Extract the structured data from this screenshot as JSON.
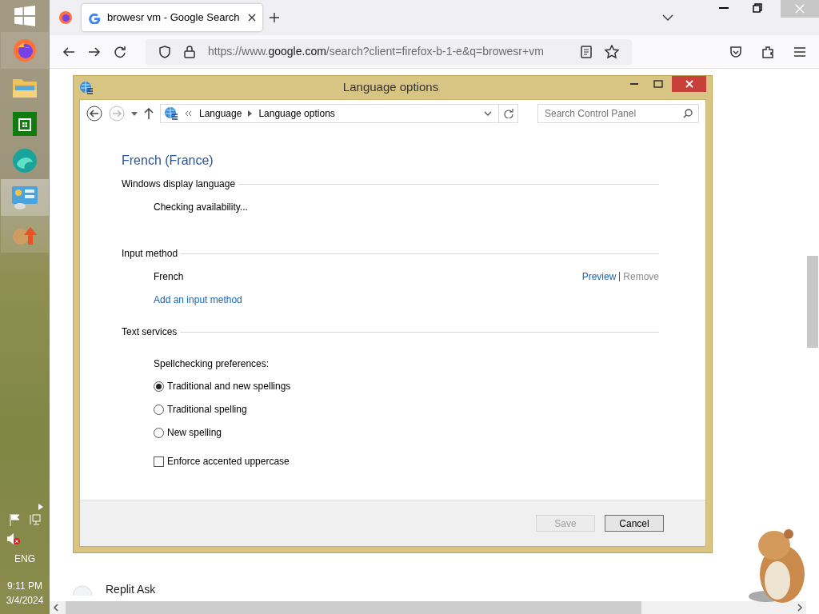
{
  "taskbar": {
    "apps": [
      {
        "kind": "firefox",
        "selected": false
      },
      {
        "kind": "explorer",
        "selected": false
      },
      {
        "kind": "store",
        "selected": false
      },
      {
        "kind": "edge",
        "selected": false
      },
      {
        "kind": "control-panel",
        "selected": true
      },
      {
        "kind": "hamster",
        "selected": false
      }
    ],
    "tray": {
      "language": "ENG",
      "time": "9:11 PM",
      "date": "3/4/2024"
    }
  },
  "browser": {
    "tabs": [
      {
        "label": "browesr vm - Google Search",
        "selected": true
      }
    ],
    "url": {
      "prefix": "https://www.",
      "host": "google.com",
      "path": "/search?client=firefox-b-1-e&q=browesr+vm"
    },
    "page": {
      "result_title": "Replit Ask"
    }
  },
  "dialog": {
    "title": "Language options",
    "breadcrumb": [
      "Language",
      "Language options"
    ],
    "search_placeholder": "Search Control Panel",
    "heading": "French (France)",
    "display_language": {
      "title": "Windows display language",
      "status": "Checking availability..."
    },
    "input_method": {
      "title": "Input method",
      "name": "French",
      "preview": "Preview",
      "remove": "Remove",
      "remove_disabled": true,
      "add": "Add an input method"
    },
    "text_services": {
      "title": "Text services",
      "label": "Spellchecking preferences:",
      "options": [
        {
          "label": "Traditional and new spellings",
          "selected": true
        },
        {
          "label": "Traditional spelling",
          "selected": false
        },
        {
          "label": "New spelling",
          "selected": false
        }
      ],
      "checkbox": {
        "label": "Enforce accented uppercase",
        "checked": false
      }
    },
    "buttons": [
      {
        "label": "Save",
        "disabled": true
      },
      {
        "label": "Cancel",
        "disabled": false
      }
    ]
  }
}
